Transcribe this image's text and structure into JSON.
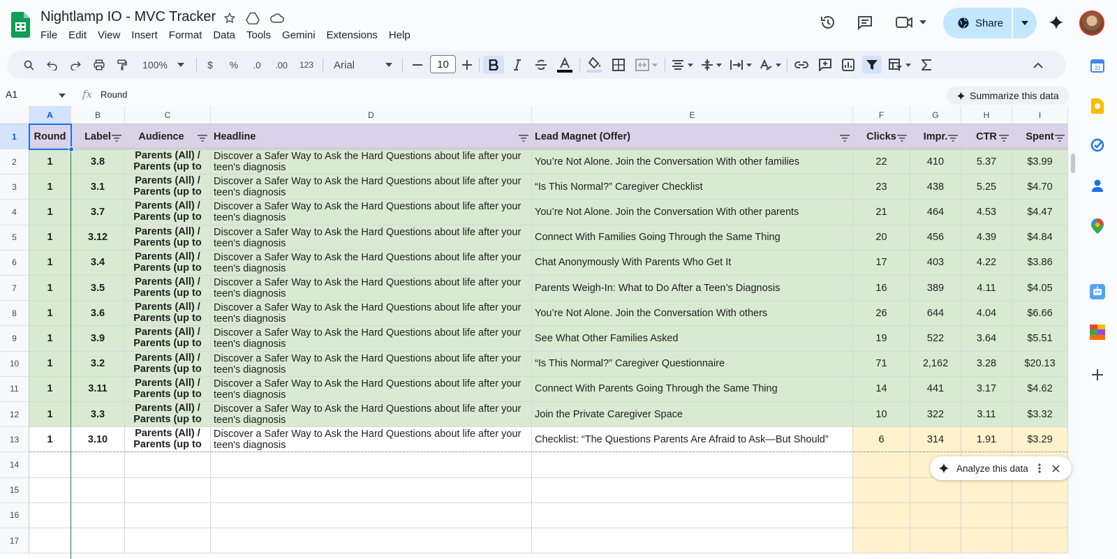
{
  "app": {
    "doc_title": "Nightlamp IO - MVC Tracker",
    "menus": [
      "File",
      "Edit",
      "View",
      "Insert",
      "Format",
      "Data",
      "Tools",
      "Gemini",
      "Extensions",
      "Help"
    ],
    "share_label": "Share"
  },
  "toolbar": {
    "zoom": "100%",
    "currency": "$",
    "percent": "%",
    "dec_decrease": ".0",
    "dec_increase": ".00",
    "number_format": "123",
    "font": "Arial",
    "font_size": "10"
  },
  "formula_bar": {
    "cell_ref": "A1",
    "fx": "fx",
    "value": "Round",
    "summarize_label": "Summarize this data"
  },
  "analyze_label": "Analyze this data",
  "columns": [
    "A",
    "B",
    "C",
    "D",
    "E",
    "F",
    "G",
    "H",
    "I"
  ],
  "header_row": [
    "Round",
    "Label",
    "Audience",
    "Headline",
    "Lead Magnet (Offer)",
    "Clicks",
    "Impr.",
    "CTR",
    "Spent"
  ],
  "rows": [
    [
      "1",
      "3.8",
      "Parents (All) / Parents (up to",
      "Discover a Safer Way to Ask the Hard Questions about life after your teen's diagnosis",
      "You’re Not Alone. Join the Conversation With other families",
      "22",
      "410",
      "5.37",
      "$3.99"
    ],
    [
      "1",
      "3.1",
      "Parents (All) / Parents (up to",
      "Discover a Safer Way to Ask the Hard Questions about life after your teen's diagnosis",
      "“Is This Normal?” Caregiver Checklist",
      "23",
      "438",
      "5.25",
      "$4.70"
    ],
    [
      "1",
      "3.7",
      "Parents (All) / Parents (up to",
      "Discover a Safer Way to Ask the Hard Questions about life after your teen's diagnosis",
      "You’re Not Alone. Join the Conversation With other parents",
      "21",
      "464",
      "4.53",
      "$4.47"
    ],
    [
      "1",
      "3.12",
      "Parents (All) / Parents (up to",
      "Discover a Safer Way to Ask the Hard Questions about life after your teen's diagnosis",
      "Connect With Families Going Through the Same Thing",
      "20",
      "456",
      "4.39",
      "$4.84"
    ],
    [
      "1",
      "3.4",
      "Parents (All) / Parents (up to",
      "Discover a Safer Way to Ask the Hard Questions about life after your teen's diagnosis",
      "Chat Anonymously With Parents Who Get It",
      "17",
      "403",
      "4.22",
      "$3.86"
    ],
    [
      "1",
      "3.5",
      "Parents (All) / Parents (up to",
      "Discover a Safer Way to Ask the Hard Questions about life after your teen's diagnosis",
      "Parents Weigh-In: What to Do After a Teen’s Diagnosis",
      "16",
      "389",
      "4.11",
      "$4.05"
    ],
    [
      "1",
      "3.6",
      "Parents (All) / Parents (up to",
      "Discover a Safer Way to Ask the Hard Questions about life after your teen's diagnosis",
      "You’re Not Alone. Join the Conversation With others",
      "26",
      "644",
      "4.04",
      "$6.66"
    ],
    [
      "1",
      "3.9",
      "Parents (All) / Parents (up to",
      "Discover a Safer Way to Ask the Hard Questions about life after your teen's diagnosis",
      "See What Other Families Asked",
      "19",
      "522",
      "3.64",
      "$5.51"
    ],
    [
      "1",
      "3.2",
      "Parents (All) / Parents (up to",
      "Discover a Safer Way to Ask the Hard Questions about life after your teen's diagnosis",
      "“Is This Normal?” Caregiver Questionnaire",
      "71",
      "2,162",
      "3.28",
      "$20.13"
    ],
    [
      "1",
      "3.11",
      "Parents (All) / Parents (up to",
      "Discover a Safer Way to Ask the Hard Questions about life after your teen's diagnosis",
      "Connect With Parents Going Through the Same Thing",
      "14",
      "441",
      "3.17",
      "$4.62"
    ],
    [
      "1",
      "3.3",
      "Parents (All) / Parents (up to",
      "Discover a Safer Way to Ask the Hard Questions about life after your teen's diagnosis",
      "Join the Private Caregiver Space",
      "10",
      "322",
      "3.11",
      "$3.32"
    ],
    [
      "1",
      "3.10",
      "Parents (All) / Parents (up to",
      "Discover a Safer Way to Ask the Hard Questions about life after your teen's diagnosis",
      "Checklist: “The Questions Parents Are Afraid to Ask—But Should”",
      "6",
      "314",
      "1.91",
      "$3.29"
    ]
  ],
  "row_numbers": [
    "1",
    "2",
    "3",
    "4",
    "5",
    "6",
    "7",
    "8",
    "9",
    "10",
    "11",
    "12",
    "13",
    "14",
    "15",
    "16",
    "17"
  ],
  "colors": {
    "header_fill": "#d9d2e9",
    "data_fill": "#d9ead3",
    "yellow_fill": "#fff2cc",
    "share_bg": "#c2e7ff",
    "selection": "#1a73e8"
  }
}
